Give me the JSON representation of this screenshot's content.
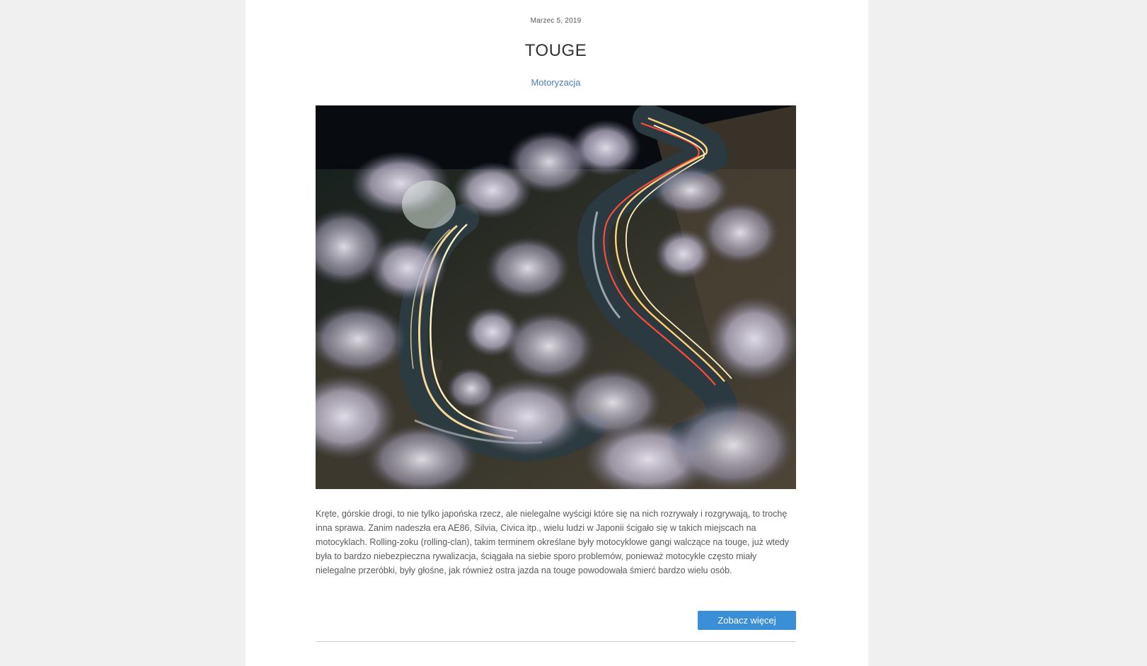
{
  "post": {
    "date": "Marzec 5, 2019",
    "title": "TOUGE",
    "category": "Motoryzacja",
    "image_alt": "Kręta górska droga nocą wśród kwitnących wiśni ze smugami świateł samochodów",
    "excerpt": "Kręte, górskie drogi, to nie tylko japońska rzecz, ale nielegalne wyścigi które się na nich rozrywały i rozgrywają, to trochę inna sprawa. Zanim nadeszła era AE86, Silvia, Civica itp., wielu ludzi w Japonii ścigało się w takich miejscach na motocyklach. Rolling-zoku (rolling-clan), takim terminem określane były motocyklowe gangi walczące na touge, już wtedy była to bardzo niebezpieczna rywalizacja, ściągała na siebie sporo problemów, ponieważ motocykle często miały nielegalne przeróbki, były głośne, jak również ostra jazda na touge powodowała śmierć bardzo wielu osób.",
    "more_button": "Zobacz więcej"
  },
  "colors": {
    "page_bg": "#f0f0f0",
    "content_bg": "#ffffff",
    "category_link": "#4a7fb5",
    "button_bg": "#3a8fd6",
    "divider": "#cfcfcf"
  }
}
